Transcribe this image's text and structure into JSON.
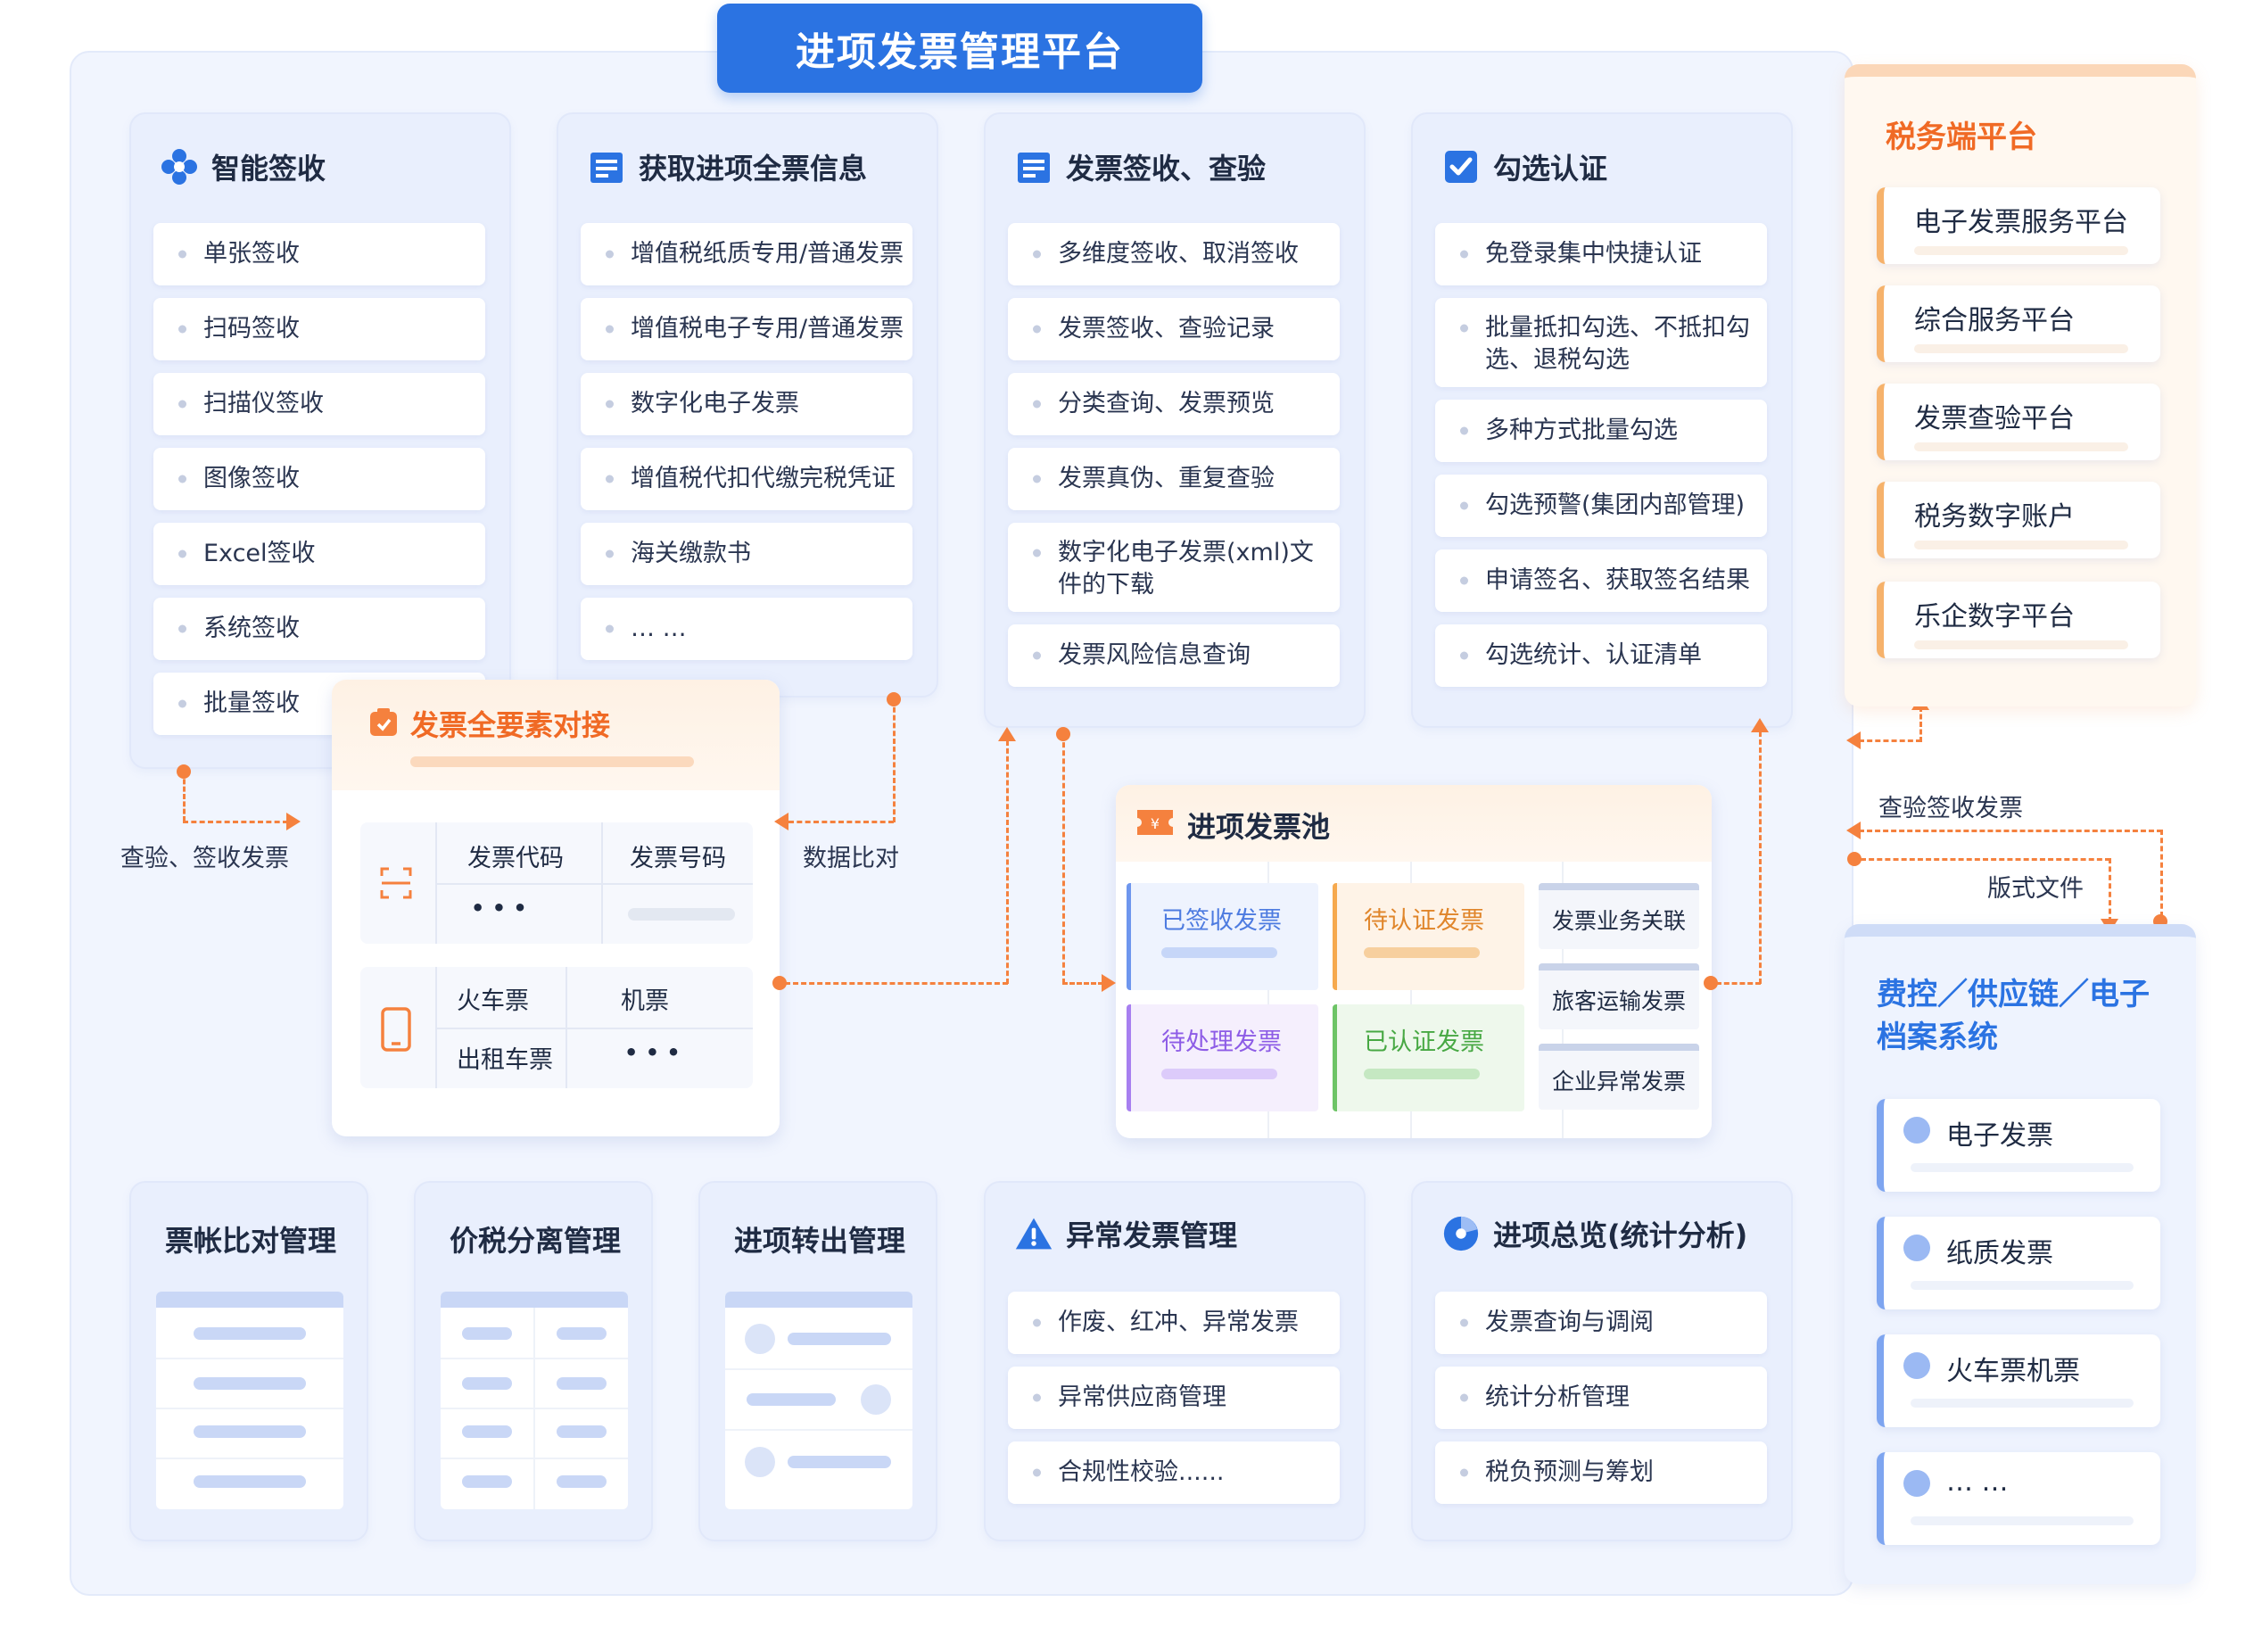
{
  "title": "进项发票管理平台",
  "colors": {
    "accent_blue": "#2b73e2",
    "accent_orange": "#f5813e"
  },
  "col_smart_receive": {
    "title": "智能签收",
    "icon": "cluster-icon",
    "items": [
      "单张签收",
      "扫码签收",
      "扫描仪签收",
      "图像签收",
      "Excel签收",
      "系统签收",
      "批量签收"
    ]
  },
  "col_get_info": {
    "title": "获取进项全票信息",
    "icon": "document-icon",
    "items": [
      "增值税纸质专用/普通发票",
      "增值税电子专用/普通发票",
      "数字化电子发票",
      "增值税代扣代缴完税凭证",
      "海关缴款书",
      "… …"
    ]
  },
  "col_receive_check": {
    "title": "发票签收、查验",
    "icon": "document-icon",
    "items": [
      "多维度签收、取消签收",
      "发票签收、查验记录",
      "分类查询、发票预览",
      "发票真伪、重复查验",
      "数字化电子发票(xml)文件的下载",
      "发票风险信息查询"
    ]
  },
  "col_certify": {
    "title": "勾选认证",
    "icon": "checkbox-icon",
    "items": [
      "免登录集中快捷认证",
      "批量抵扣勾选、不抵扣勾选、退税勾选",
      "多种方式批量勾选",
      "勾选预警(集团内部管理)",
      "申请签名、获取签名结果",
      "勾选统计、认证清单"
    ]
  },
  "elements_panel": {
    "title": "发票全要素对接",
    "field_invoice_code": "发票代码",
    "field_invoice_number": "发票号码",
    "ellipsis": "• • •",
    "train": "火车票",
    "plane": "机票",
    "taxi": "出租车票"
  },
  "pool": {
    "title": "进项发票池",
    "signed": "已签收发票",
    "to_certify": "待认证发票",
    "to_process": "待处理发票",
    "certified": "已认证发票",
    "biz_link": "发票业务关联",
    "passenger": "旅客运输发票",
    "abnormal": "企业异常发票"
  },
  "labels": {
    "check_receive": "查验、签收发票",
    "data_compare": "数据比对",
    "check_receive_right": "查验签收发票",
    "layout_file": "版式文件"
  },
  "tax_platform": {
    "title": "税务端平台",
    "items": [
      "电子发票服务平台",
      "综合服务平台",
      "发票查验平台",
      "税务数字账户",
      "乐企数字平台"
    ]
  },
  "erp_system": {
    "title": "费控／供应链／电子档案系统",
    "items": [
      "电子发票",
      "纸质发票",
      "火车票机票",
      "… …"
    ]
  },
  "bottom": {
    "ledger": "票帐比对管理",
    "split": "价税分离管理",
    "transfer": "进项转出管理",
    "abnormal_title": "异常发票管理",
    "abnormal_items": [
      "作废、红冲、异常发票",
      "异常供应商管理",
      "合规性校验......"
    ],
    "overview_title": "进项总览(统计分析)",
    "overview_items": [
      "发票查询与调阅",
      "统计分析管理",
      "税负预测与筹划"
    ]
  }
}
